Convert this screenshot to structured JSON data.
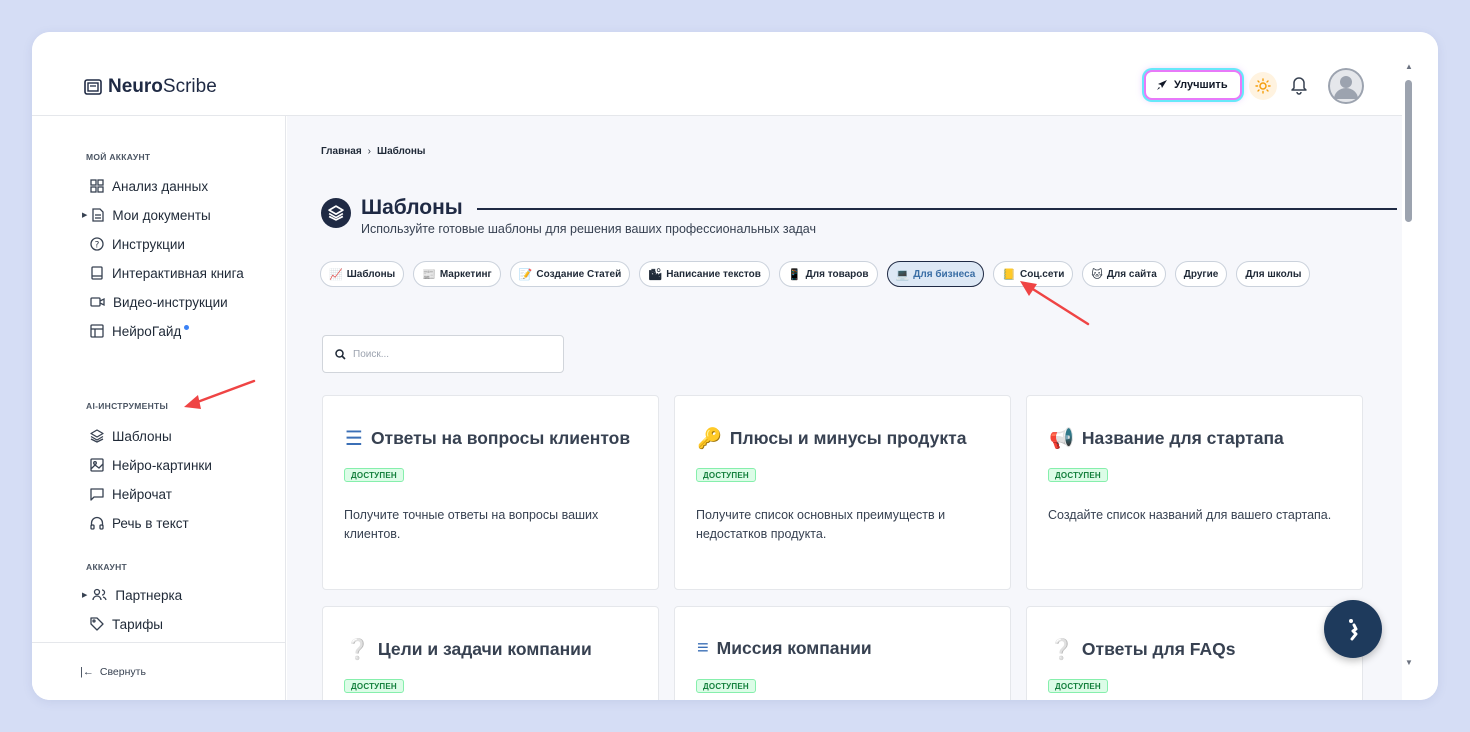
{
  "header": {
    "logo_bold": "Neuro",
    "logo_rest": "Scribe",
    "upgrade_label": "Улучшить"
  },
  "sidebar": {
    "section_account": "МОЙ АККАУНТ",
    "account_items": [
      {
        "label": "Анализ данных",
        "icon": "grid-icon"
      },
      {
        "label": "Мои документы",
        "icon": "document-icon"
      },
      {
        "label": "Инструкции",
        "icon": "help-circle-icon"
      },
      {
        "label": "Интерактивная книга",
        "icon": "book-icon"
      },
      {
        "label": "Видео-инструкции",
        "icon": "video-icon"
      },
      {
        "label": "НейроГайд",
        "icon": "layout-icon"
      }
    ],
    "section_ai": "AI-ИНСТРУМЕНТЫ",
    "ai_items": [
      {
        "label": "Шаблоны",
        "icon": "layers-icon"
      },
      {
        "label": "Нейро-картинки",
        "icon": "image-icon"
      },
      {
        "label": "Нейрочат",
        "icon": "chat-icon"
      },
      {
        "label": "Речь в текст",
        "icon": "headphones-icon"
      }
    ],
    "section_profile": "АККАУНТ",
    "profile_items": [
      {
        "label": "Партнерка",
        "icon": "users-icon"
      },
      {
        "label": "Тарифы",
        "icon": "tag-icon"
      }
    ],
    "collapse_label": "Свернуть"
  },
  "main": {
    "breadcrumb": [
      "Главная",
      "Шаблоны"
    ],
    "breadcrumb_sep": "›",
    "title": "Шаблоны",
    "subtitle": "Используйте готовые шаблоны для решения ваших профессиональных задач",
    "chips": [
      {
        "label": "Шаблоны",
        "emoji": "📈",
        "active": false
      },
      {
        "label": "Маркетинг",
        "emoji": "📰",
        "active": false
      },
      {
        "label": "Создание Статей",
        "emoji": "📝",
        "active": false
      },
      {
        "label": "Написание текстов",
        "emoji": "🏙",
        "active": false
      },
      {
        "label": "Для товаров",
        "emoji": "📱",
        "active": false
      },
      {
        "label": "Для бизнеса",
        "emoji": "💻",
        "active": true
      },
      {
        "label": "Соц.сети",
        "emoji": "📒",
        "active": false
      },
      {
        "label": "Для сайта",
        "emoji": "🐱",
        "active": false
      },
      {
        "label": "Другие",
        "emoji": "",
        "active": false
      },
      {
        "label": "Для школы",
        "emoji": "",
        "active": false
      }
    ],
    "search_placeholder": "Поиск...",
    "cards": [
      {
        "title": "Ответы на вопросы клиентов",
        "emoji": "☰",
        "badge": "ДОСТУПЕН",
        "desc": "Получите точные ответы на вопросы ваших клиентов."
      },
      {
        "title": "Плюсы и минусы продукта",
        "emoji": "🔑",
        "badge": "ДОСТУПЕН",
        "desc": "Получите список основных преимуществ и недостатков продукта."
      },
      {
        "title": "Название для стартапа",
        "emoji": "📢",
        "badge": "ДОСТУПЕН",
        "desc": "Создайте список названий для вашего стартапа."
      },
      {
        "title": "Цели и задачи компании",
        "emoji": "❔",
        "badge": "ДОСТУПЕН",
        "desc": ""
      },
      {
        "title": "Миссия компании",
        "emoji": "≡",
        "badge": "ДОСТУПЕН",
        "desc": ""
      },
      {
        "title": "Ответы для FAQs",
        "emoji": "❔",
        "badge": "ДОСТУПЕН",
        "desc": ""
      }
    ]
  },
  "colors": {
    "brand_dark": "#1f2a44",
    "badge_green": "#dcfce7",
    "annotation_red": "#ef4444",
    "active_chip_bg": "#dde8f5"
  }
}
